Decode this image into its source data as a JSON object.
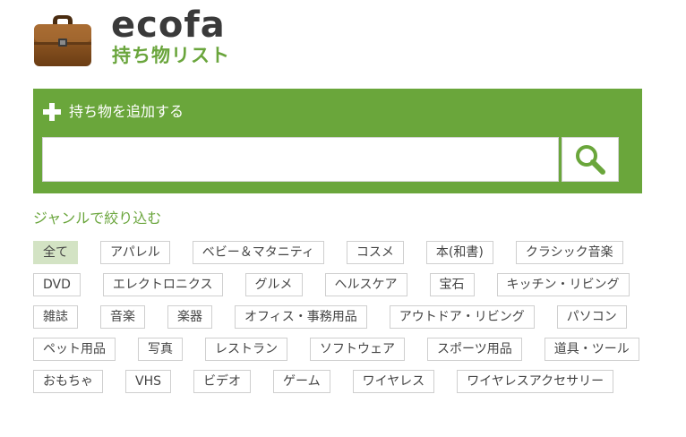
{
  "logo": {
    "title": "ecofa",
    "subtitle": "持ち物リスト",
    "icon": "briefcase-icon"
  },
  "add_panel": {
    "title": "持ち物を追加する",
    "plus_icon": "plus-icon",
    "search": {
      "value": "",
      "placeholder": ""
    },
    "search_icon": "search-icon"
  },
  "filter": {
    "title": "ジャンルで絞り込む",
    "active_index": 0,
    "tags": [
      "全て",
      "アパレル",
      "ベビー＆マタニティ",
      "コスメ",
      "本(和書)",
      "クラシック音楽",
      "DVD",
      "エレクトロニクス",
      "グルメ",
      "ヘルスケア",
      "宝石",
      "キッチン・リビング",
      "雑誌",
      "音楽",
      "楽器",
      "オフィス・事務用品",
      "アウトドア・リビング",
      "パソコン",
      "ペット用品",
      "写真",
      "レストラン",
      "ソフトウェア",
      "スポーツ用品",
      "道具・ツール",
      "おもちゃ",
      "VHS",
      "ビデオ",
      "ゲーム",
      "ワイヤレス",
      "ワイヤレスアクセサリー"
    ]
  },
  "colors": {
    "accent": "#6aa63b",
    "active_tag_bg": "#d3e3c4"
  }
}
